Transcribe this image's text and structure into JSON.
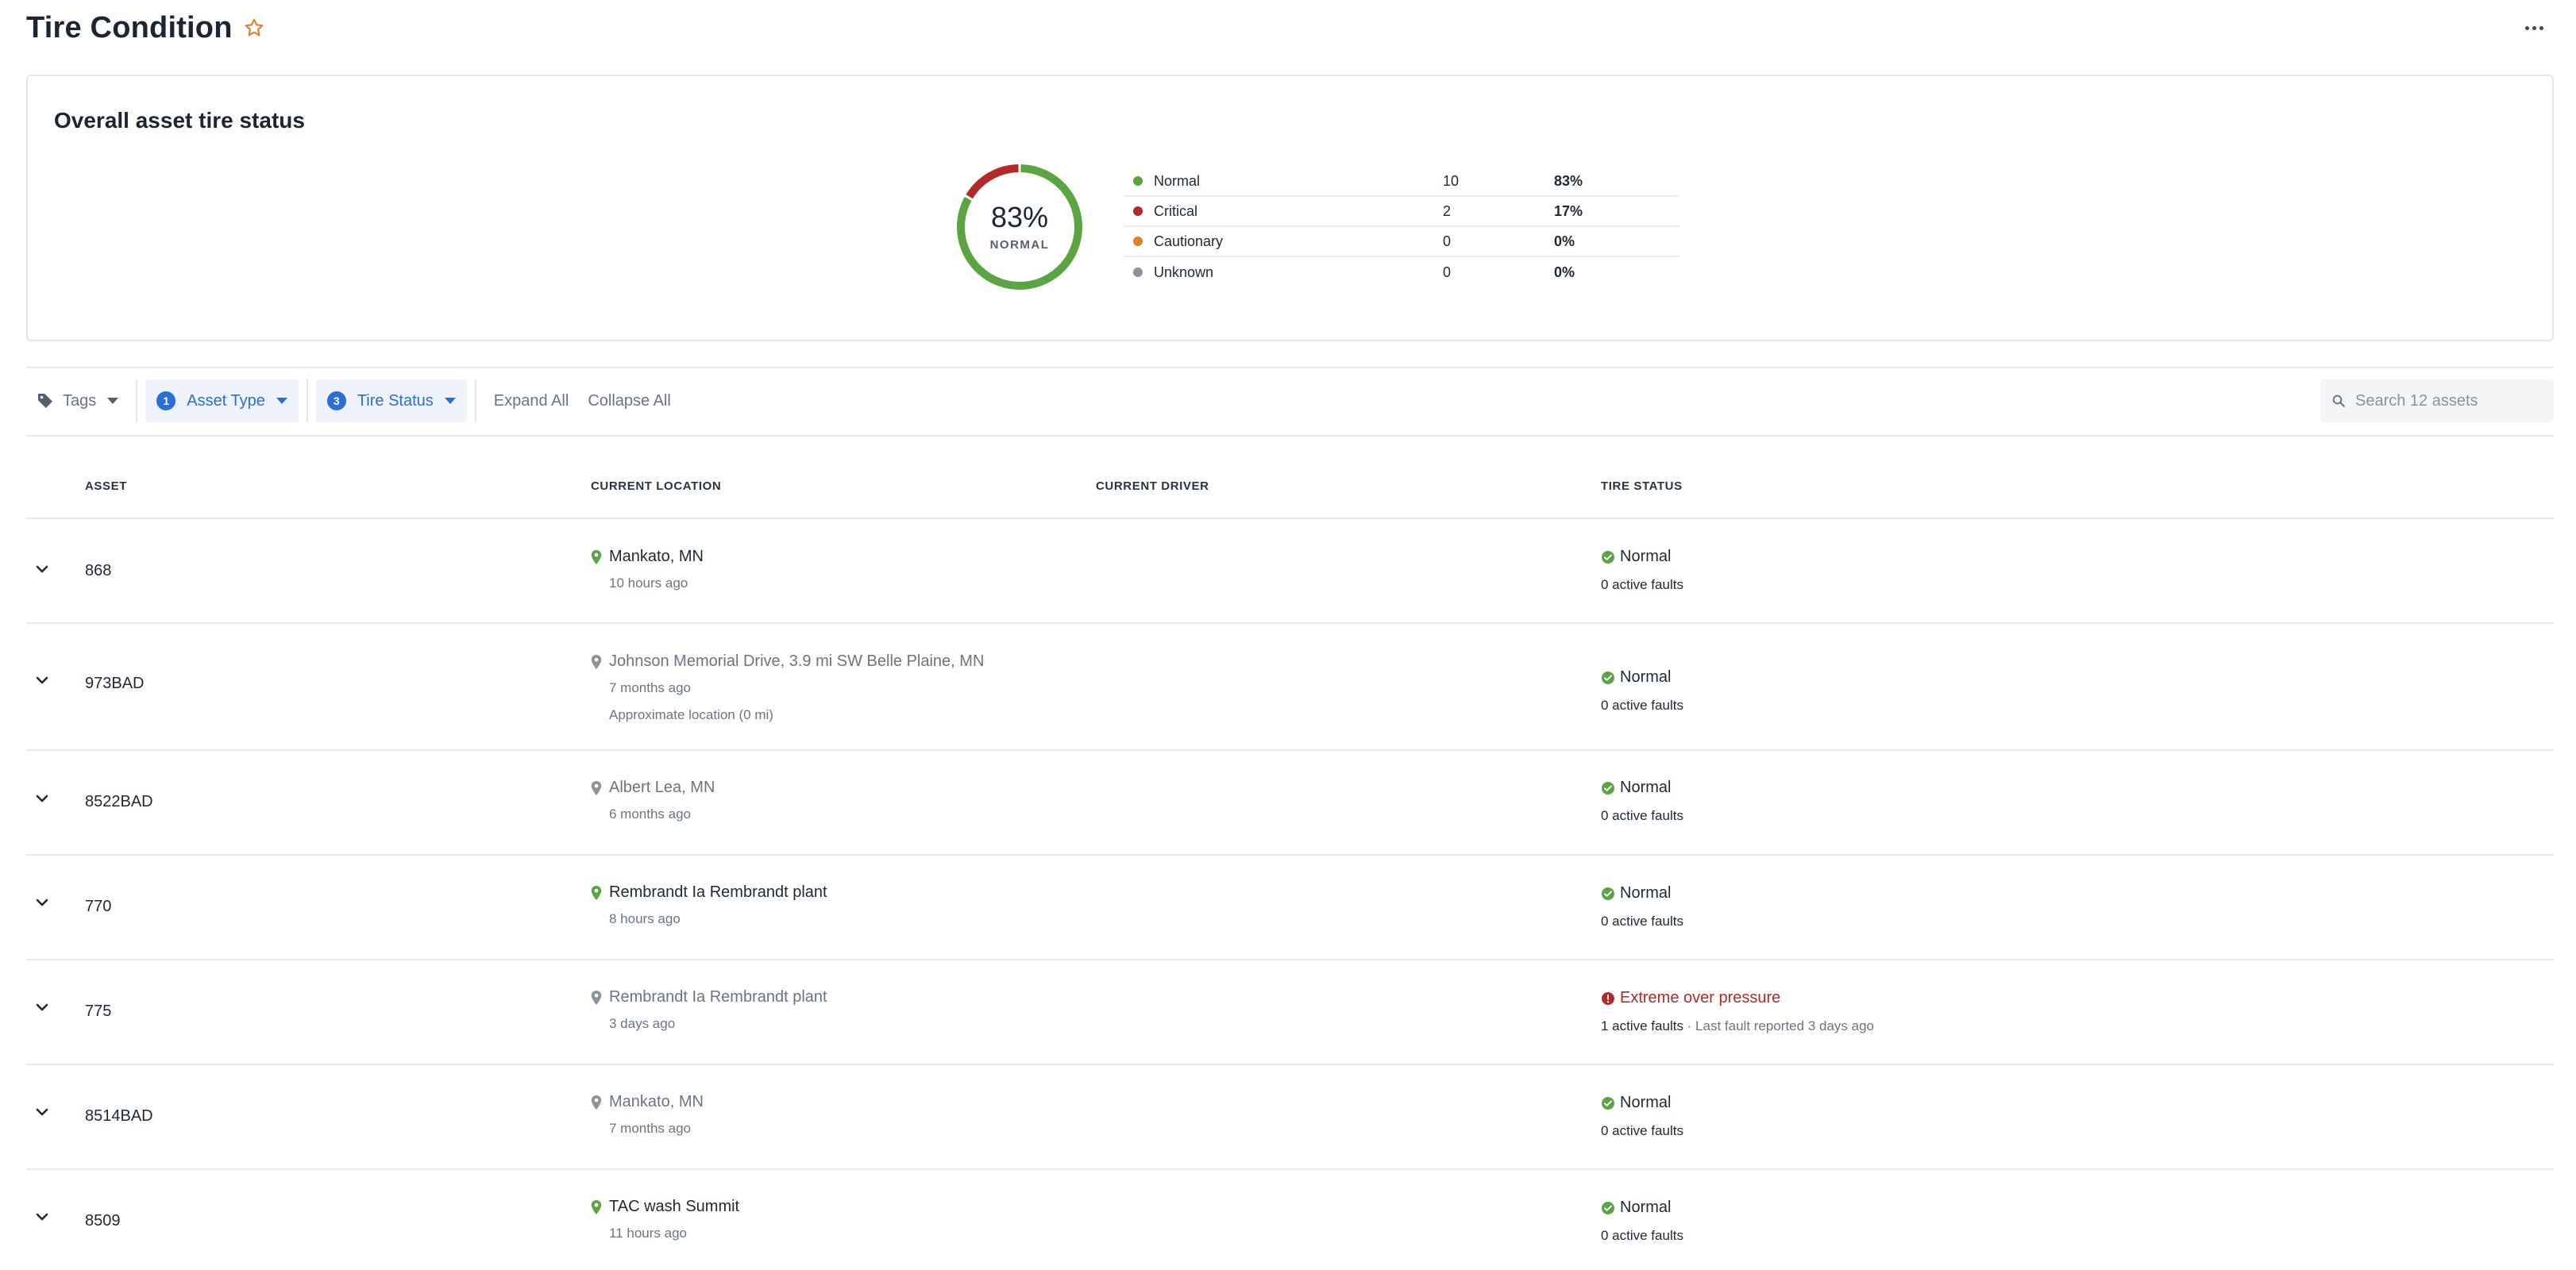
{
  "header": {
    "title": "Tire Condition",
    "favorite_icon": "star-outline-icon",
    "more_icon": "more-horizontal-icon"
  },
  "summary": {
    "title": "Overall asset tire status",
    "center_percent": "83%",
    "center_label": "NORMAL",
    "legend": [
      {
        "name": "Normal",
        "count": "10",
        "percent": "83%",
        "color": "#5aa542"
      },
      {
        "name": "Critical",
        "count": "2",
        "percent": "17%",
        "color": "#b4282a"
      },
      {
        "name": "Cautionary",
        "count": "0",
        "percent": "0%",
        "color": "#e0802e"
      },
      {
        "name": "Unknown",
        "count": "0",
        "percent": "0%",
        "color": "#8b939b"
      }
    ]
  },
  "chart_data": {
    "type": "pie",
    "title": "",
    "series": [
      {
        "name": "Normal",
        "value": 10,
        "color": "#5aa542"
      },
      {
        "name": "Critical",
        "value": 2,
        "color": "#b4282a"
      },
      {
        "name": "Cautionary",
        "value": 0,
        "color": "#e0802e"
      },
      {
        "name": "Unknown",
        "value": 0,
        "color": "#8b939b"
      }
    ]
  },
  "toolbar": {
    "tags_label": "Tags",
    "asset_type": {
      "count": "1",
      "label": "Asset Type"
    },
    "tire_status": {
      "count": "3",
      "label": "Tire Status"
    },
    "expand_all": "Expand All",
    "collapse_all": "Collapse All",
    "search_placeholder": "Search 12 assets"
  },
  "table": {
    "columns": {
      "asset": "ASSET",
      "location": "CURRENT LOCATION",
      "driver": "CURRENT DRIVER",
      "status": "TIRE STATUS"
    },
    "rows": [
      {
        "asset": "868",
        "location": "Mankato, MN",
        "time": "10 hours ago",
        "note": "",
        "status": "Normal",
        "faults": "0 active faults",
        "fault_note": "",
        "fresh": true,
        "critical": false
      },
      {
        "asset": "973BAD",
        "location": "Johnson Memorial Drive, 3.9 mi SW Belle Plaine, MN",
        "time": "7 months ago",
        "note": "Approximate location (0 mi)",
        "status": "Normal",
        "faults": "0 active faults",
        "fault_note": "",
        "fresh": false,
        "critical": false
      },
      {
        "asset": "8522BAD",
        "location": "Albert Lea, MN",
        "time": "6 months ago",
        "note": "",
        "status": "Normal",
        "faults": "0 active faults",
        "fault_note": "",
        "fresh": false,
        "critical": false
      },
      {
        "asset": "770",
        "location": "Rembrandt Ia Rembrandt plant",
        "time": "8 hours ago",
        "note": "",
        "status": "Normal",
        "faults": "0 active faults",
        "fault_note": "",
        "fresh": true,
        "critical": false
      },
      {
        "asset": "775",
        "location": "Rembrandt Ia Rembrandt plant",
        "time": "3 days ago",
        "note": "",
        "status": "Extreme over pressure",
        "faults": "1 active faults",
        "fault_note": " · Last fault reported 3 days ago",
        "fresh": false,
        "critical": true
      },
      {
        "asset": "8514BAD",
        "location": "Mankato, MN",
        "time": "7 months ago",
        "note": "",
        "status": "Normal",
        "faults": "0 active faults",
        "fault_note": "",
        "fresh": false,
        "critical": false
      },
      {
        "asset": "8509",
        "location": "TAC wash Summit",
        "time": "11 hours ago",
        "note": "",
        "status": "Normal",
        "faults": "0 active faults",
        "fault_note": "",
        "fresh": true,
        "critical": false
      }
    ]
  }
}
